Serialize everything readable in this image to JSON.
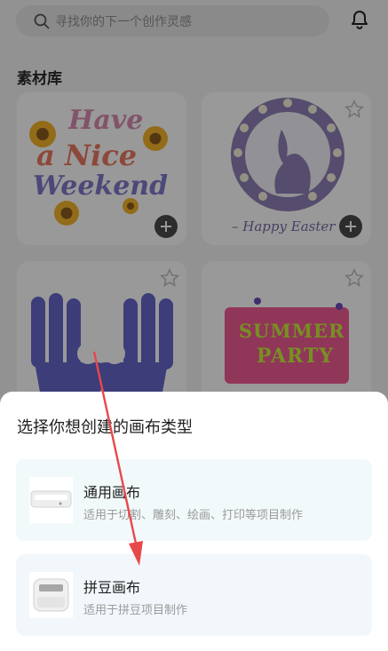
{
  "search": {
    "placeholder": "寻找你的下一个创作灵感",
    "icon": "search-icon"
  },
  "header": {
    "notification_icon": "bell-icon"
  },
  "library": {
    "title": "素材库",
    "cards": [
      {
        "art": "Have a Nice Weekend",
        "lines": [
          "Have",
          "a Nice",
          "Weekend"
        ]
      },
      {
        "art": "– Happy Easter –",
        "caption": "– Happy Easter –"
      },
      {
        "art": "ok-hand-gesture"
      },
      {
        "art": "SUMMER PARTY",
        "lines": [
          "SUMMER",
          "PARTY"
        ]
      }
    ]
  },
  "sheet": {
    "title": "选择你想创建的画布类型",
    "options": [
      {
        "name": "通用画布",
        "desc": "适用于切割、雕刻、绘画、打印等项目制作",
        "icon": "general-machine-image"
      },
      {
        "name": "拼豆画布",
        "desc": "适用于拼豆项目制作",
        "icon": "bead-machine-image"
      }
    ]
  },
  "colors": {
    "accent_arrow": "#e8484a",
    "overlay": "rgba(0,0,0,0.40)"
  }
}
